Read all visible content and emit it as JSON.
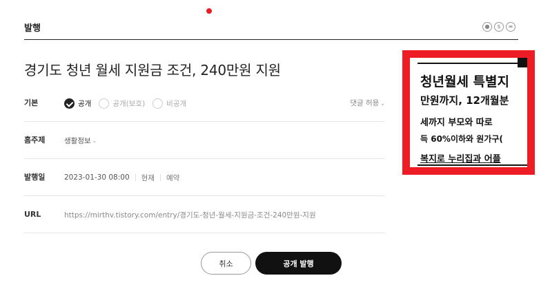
{
  "header": {
    "title": "발행",
    "icons": [
      "accessibility-icon",
      "no-ads-icon",
      "menu-icon"
    ]
  },
  "post": {
    "title": "경기도 청년 월세 지원금 조건, 240만원 지원"
  },
  "rows": {
    "basic": {
      "label": "기본",
      "options": [
        {
          "label": "공개",
          "checked": true
        },
        {
          "label": "공개(보호)",
          "checked": false
        },
        {
          "label": "비공개",
          "checked": false
        }
      ],
      "comment_label": "댓글 허용"
    },
    "topic": {
      "label": "홈주제",
      "value": "생활정보"
    },
    "date": {
      "label": "발행일",
      "value": "2023-01-30 08:00",
      "now": "현재",
      "reserve": "예약"
    },
    "url": {
      "label": "URL",
      "value": "https://mirthv.tistory.com/entry/경기도-청년-월세-지원금-조건-240만원-지원"
    }
  },
  "buttons": {
    "cancel": "취소",
    "publish": "공개 발행"
  },
  "thumbnail": {
    "lines": [
      "청년월세 특별지",
      "만원까지, 12개월분",
      "세까지 부모와 따로",
      "득 60%이하와 원가구(",
      "복지로 누리집과 어플"
    ]
  },
  "colors": {
    "accent": "#ee1c25",
    "primary_button": "#111111"
  }
}
